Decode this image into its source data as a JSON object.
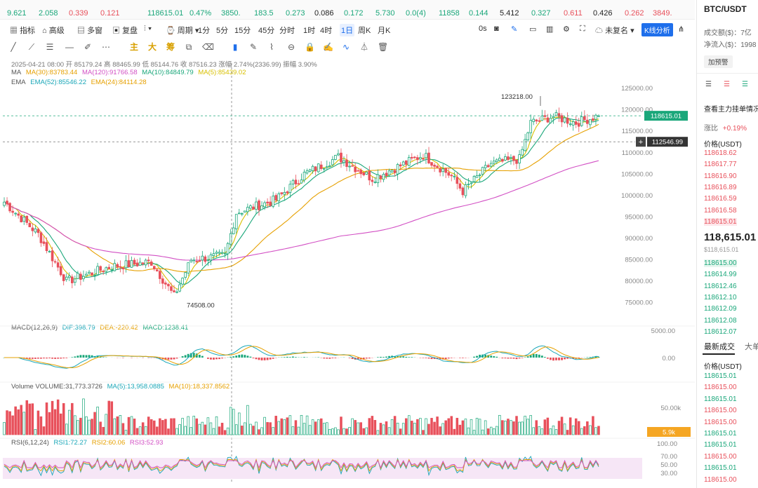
{
  "top_strip": [
    "9.621",
    "2.058",
    "0.339",
    "0.121",
    "118615.01",
    "0.47%",
    "3850.",
    "183.5",
    "0.273",
    "0.086",
    "0.172",
    "5.730",
    "0.0(4)",
    "11858",
    "0.144",
    "5.412",
    "0.327",
    "0.611",
    "0.426",
    "0.262",
    "3849."
  ],
  "top_strip_colors": [
    "#1aa77a",
    "#1aa77a",
    "#e8505b",
    "#e8505b",
    "#1aa77a",
    "#1aa77a",
    "#1aa77a",
    "#1aa77a",
    "#1aa77a",
    "#222",
    "#1aa77a",
    "#1aa77a",
    "#1aa77a",
    "#1aa77a",
    "#1aa77a",
    "#222",
    "#1aa77a",
    "#e8505b",
    "#222",
    "#e8505b",
    "#e8505b"
  ],
  "toolbar": {
    "indicator": "指标",
    "advanced": "高级",
    "multi_window": "多窗",
    "replay": "复盘",
    "period": "周期",
    "periods": [
      "1分",
      "5分",
      "15分",
      "45分",
      "分时",
      "1时",
      "4时",
      "1日",
      "周K",
      "月K"
    ],
    "active_period": "1日",
    "os": "0s",
    "adjust": "未复名",
    "kline_analysis": "K线分析"
  },
  "draw_tools": {
    "main": "主",
    "big": "大",
    "chip": "筹"
  },
  "legend": {
    "line1": "2025-04-21 08:00  开 85179.24  高 88465.99  低 85144.76  收 87516.23  涨幅 2.74%(2336.99)  振幅 3.90%",
    "ma_label": "MA",
    "ma30": "MA(30):83783.44",
    "ma120": "MA(120):91766.58",
    "ma10": "MA(10):84849.79",
    "ma5": "MA(5):85439.02",
    "ema_label": "EMA",
    "ema52": "EMA(52):85546.22",
    "ema24": "EMA(24):84114.28",
    "macd_label": "MACD(12,26,9)",
    "dif": "DIF:398.79",
    "dea": "DEA:-220.42",
    "macd": "MACD:1238.41",
    "volume_label": "Volume  VOLUME:31,773.3726",
    "vol_ma5": "MA(5):13,958.0885",
    "vol_ma10": "MA(10):18,337.8562",
    "rsi_label": "RSI(6,12,24)",
    "rsi1": "RSI1:72.27",
    "rsi2": "RSI2:60.06",
    "rsi3": "RSI3:52.93"
  },
  "chart": {
    "high_label": "123218.00",
    "low_label": "74508.00",
    "last_price_label": "118615.01",
    "cursor_price_label": "112546.99",
    "volume_badge": "5.9k",
    "price_ticks": [
      "125000.00",
      "120000.00",
      "115000.00",
      "110000.00",
      "105000.00",
      "100000.00",
      "95000.00",
      "90000.00",
      "85000.00",
      "80000.00",
      "75000.00"
    ],
    "macd_ticks": [
      "5000.00",
      "0.00"
    ],
    "volume_ticks": [
      "50.00k"
    ],
    "rsi_ticks": [
      "100.00",
      "70.00",
      "50.00",
      "30.00"
    ]
  },
  "chart_data": {
    "type": "candlestick",
    "y_range": [
      72000,
      126000
    ],
    "high": 123218,
    "low": 74508,
    "last": 118615.01,
    "key_closes": [
      {
        "t": 0,
        "v": 98500
      },
      {
        "t": 12,
        "v": 91000
      },
      {
        "t": 22,
        "v": 80000
      },
      {
        "t": 38,
        "v": 83500
      },
      {
        "t": 52,
        "v": 84500
      },
      {
        "t": 60,
        "v": 76500
      },
      {
        "t": 66,
        "v": 85000
      },
      {
        "t": 78,
        "v": 86000
      },
      {
        "t": 82,
        "v": 96000
      },
      {
        "t": 96,
        "v": 99000
      },
      {
        "t": 106,
        "v": 105000
      },
      {
        "t": 118,
        "v": 109000
      },
      {
        "t": 130,
        "v": 104000
      },
      {
        "t": 140,
        "v": 107000
      },
      {
        "t": 148,
        "v": 109500
      },
      {
        "t": 158,
        "v": 104500
      },
      {
        "t": 162,
        "v": 101000
      },
      {
        "t": 172,
        "v": 107500
      },
      {
        "t": 182,
        "v": 108500
      },
      {
        "t": 186,
        "v": 117000
      },
      {
        "t": 194,
        "v": 118500
      },
      {
        "t": 202,
        "v": 117000
      },
      {
        "t": 210,
        "v": 118615
      }
    ]
  },
  "sidebar": {
    "title": "BTC/USDT",
    "turnover": "成交额($)：7亿",
    "net_inflow": "净流入($)：1998",
    "add_alert": "加预警",
    "view_main": "查看主力挂单情况",
    "change_label": "涨比",
    "change_value": "+0.19%",
    "price_header": "价格(USDT)",
    "asks": [
      "118618.62",
      "118617.77",
      "118616.90",
      "118616.89",
      "118616.59",
      "118616.58",
      "118615.01"
    ],
    "last_price": "118,615.01",
    "last_price_usd": "$118,615.01",
    "bids": [
      "118615.00",
      "118614.99",
      "118612.46",
      "118612.10",
      "118612.09",
      "118612.08",
      "118612.07"
    ],
    "trades_tab": "最新成交",
    "big_tab": "大单",
    "trades_header": "价格(USDT)",
    "trades": [
      {
        "p": "118615.01",
        "c": "green"
      },
      {
        "p": "118615.00",
        "c": "red"
      },
      {
        "p": "118615.01",
        "c": "green"
      },
      {
        "p": "118615.00",
        "c": "red"
      },
      {
        "p": "118615.00",
        "c": "red"
      },
      {
        "p": "118615.01",
        "c": "green"
      },
      {
        "p": "118615.01",
        "c": "green"
      },
      {
        "p": "118615.00",
        "c": "red"
      },
      {
        "p": "118615.01",
        "c": "green"
      },
      {
        "p": "118615.00",
        "c": "red"
      },
      {
        "p": "118615.01",
        "c": "green"
      }
    ]
  }
}
